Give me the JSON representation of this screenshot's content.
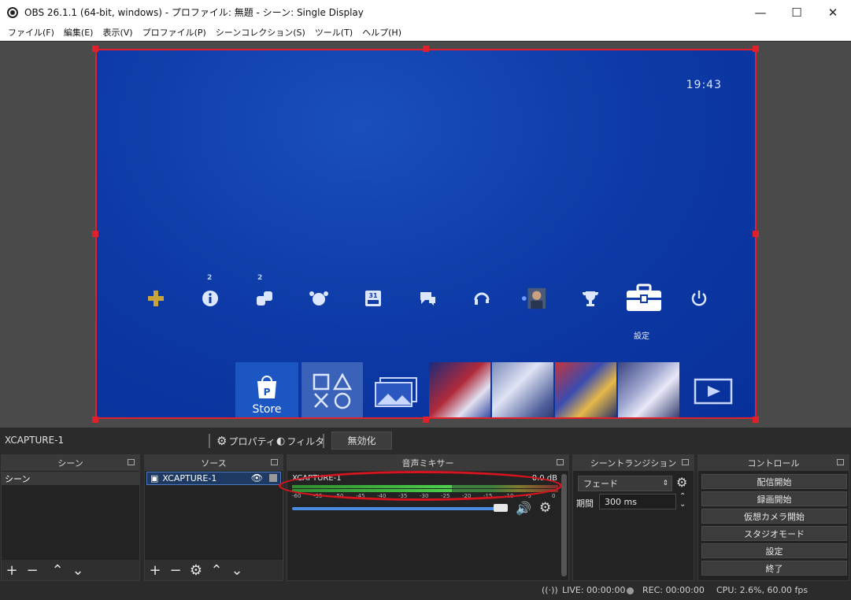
{
  "window": {
    "title": "OBS 26.1.1 (64-bit, windows) - プロファイル: 無題 - シーン: Single Display",
    "minimize": "—",
    "maximize": "☐",
    "close": "✕"
  },
  "menu": [
    "ファイル(F)",
    "編集(E)",
    "表示(V)",
    "プロファイル(P)",
    "シーンコレクション(S)",
    "ツール(T)",
    "ヘルプ(H)"
  ],
  "preview": {
    "clock": "19:43",
    "badge_info": "2",
    "badge_friends": "2",
    "settings_label": "設定",
    "store_label": "Store",
    "colors": {
      "frame": "#e0202a",
      "background": "#0d3aa6"
    }
  },
  "source_toolbar": {
    "source_name": "XCAPTURE-1",
    "properties": "プロパティ",
    "filters": "フィルタ",
    "disable": "無効化"
  },
  "scenes": {
    "header": "シーン",
    "items": [
      "シーン"
    ]
  },
  "sources": {
    "header": "ソース",
    "items": [
      "XCAPTURE-1"
    ]
  },
  "mixer": {
    "header": "音声ミキサー",
    "channel": "XCAPTURE-1",
    "db": "0.0 dB",
    "ticks": [
      "-60",
      "-55",
      "-50",
      "-45",
      "-40",
      "-35",
      "-30",
      "-25",
      "-20",
      "-15",
      "-10",
      "-5",
      "0"
    ]
  },
  "transitions": {
    "header": "シーントランジション",
    "selected": "フェード",
    "duration_label": "期間",
    "duration_value": "300 ms"
  },
  "controls": {
    "header": "コントロール",
    "buttons": [
      "配信開始",
      "録画開始",
      "仮想カメラ開始",
      "スタジオモード",
      "設定",
      "終了"
    ]
  },
  "status": {
    "live": "LIVE: 00:00:00",
    "rec": "REC: 00:00:00",
    "cpu": "CPU: 2.6%, 60.00 fps"
  }
}
